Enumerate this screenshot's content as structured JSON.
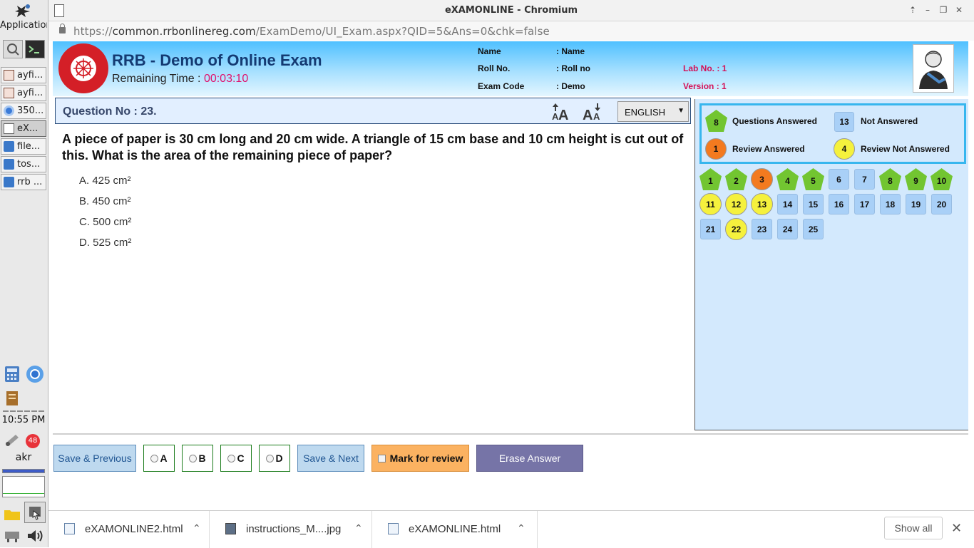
{
  "taskbar": {
    "apps_label": "Applications",
    "items": [
      {
        "label": "ayfi...",
        "icon": "document-icon"
      },
      {
        "label": "ayfi...",
        "icon": "document-icon"
      },
      {
        "label": "350...",
        "icon": "chromium-icon"
      },
      {
        "label": "eX...",
        "icon": "page-icon"
      },
      {
        "label": "file...",
        "icon": "folder-icon"
      },
      {
        "label": "tos...",
        "icon": "folder-icon"
      },
      {
        "label": "rrb ...",
        "icon": "folder-icon"
      }
    ],
    "clock": "10:55 PM",
    "notification_count": "48",
    "user": "akr"
  },
  "browser": {
    "window_title": "eXAMONLINE - Chromium",
    "url_scheme": "https://",
    "url_host": "common.rrbonlinereg.com",
    "url_path": "/ExamDemo/UI_Exam.aspx?QID=5&Ans=0&chk=false"
  },
  "exam": {
    "title": "RRB - Demo of Online Exam",
    "remaining_label": "Remaining Time : ",
    "remaining_time": "00:03:10",
    "candidate": {
      "name_label": "Name",
      "name_value": ": Name",
      "roll_label": "Roll No.",
      "roll_value": ": Roll no",
      "code_label": "Exam Code",
      "code_value": ": Demo",
      "lab_label": "Lab No. :",
      "lab_value": "1",
      "version_label": "Version :",
      "version_value": "1"
    },
    "question_no": "Question No : 23.",
    "language": "ENGLISH",
    "question_text": "A piece of paper is 30 cm long and 20 cm wide. A triangle of 15 cm base and 10 cm height is cut out of this. What is the area of the remaining piece of paper?",
    "options": [
      "A. 425 cm²",
      "B. 450 cm²",
      "C. 500 cm²",
      "D. 525 cm²"
    ]
  },
  "palette": {
    "legend": {
      "answered_count": "8",
      "answered_label": "Questions Answered",
      "not_answered_count": "13",
      "not_answered_label": "Not Answered",
      "review_answered_count": "1",
      "review_answered_label": "Review Answered",
      "review_not_answered_count": "4",
      "review_not_answered_label": "Review Not Answered"
    },
    "questions": [
      {
        "n": "1",
        "status": "answered"
      },
      {
        "n": "2",
        "status": "answered"
      },
      {
        "n": "3",
        "status": "review-answered"
      },
      {
        "n": "4",
        "status": "answered"
      },
      {
        "n": "5",
        "status": "answered"
      },
      {
        "n": "6",
        "status": "not-answered"
      },
      {
        "n": "7",
        "status": "not-answered"
      },
      {
        "n": "8",
        "status": "answered"
      },
      {
        "n": "9",
        "status": "answered"
      },
      {
        "n": "10",
        "status": "answered"
      },
      {
        "n": "11",
        "status": "review-not-answered"
      },
      {
        "n": "12",
        "status": "review-not-answered"
      },
      {
        "n": "13",
        "status": "review-not-answered"
      },
      {
        "n": "14",
        "status": "not-answered"
      },
      {
        "n": "15",
        "status": "not-answered"
      },
      {
        "n": "16",
        "status": "not-answered"
      },
      {
        "n": "17",
        "status": "not-answered"
      },
      {
        "n": "18",
        "status": "not-answered"
      },
      {
        "n": "19",
        "status": "not-answered"
      },
      {
        "n": "20",
        "status": "not-answered"
      },
      {
        "n": "21",
        "status": "not-answered"
      },
      {
        "n": "22",
        "status": "review-not-answered"
      },
      {
        "n": "23",
        "status": "not-answered"
      },
      {
        "n": "24",
        "status": "not-answered"
      },
      {
        "n": "25",
        "status": "not-answered"
      }
    ]
  },
  "actions": {
    "save_previous": "Save & Previous",
    "option_a": "A",
    "option_b": "B",
    "option_c": "C",
    "option_d": "D",
    "save_next": "Save & Next",
    "mark_review": "Mark for review",
    "erase": "Erase Answer"
  },
  "downloads": {
    "items": [
      "eXAMONLINE2.html",
      "instructions_M....jpg",
      "eXAMONLINE.html"
    ],
    "show_all": "Show all"
  },
  "colors": {
    "header_gradient_top": "#4fc0ff",
    "timer": "#e0116c",
    "answered": "#72c531",
    "review_answered": "#f37a1f",
    "review_not_answered": "#f5f13d",
    "not_answered": "#a9d0f7",
    "erase": "#7674a7",
    "mark_review": "#fbb261"
  }
}
